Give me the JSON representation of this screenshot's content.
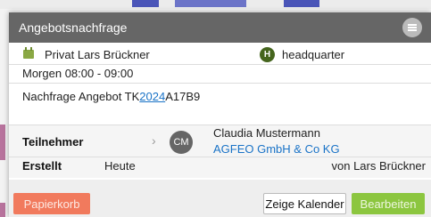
{
  "dialog": {
    "title": "Angebotsnachfrage"
  },
  "appointment": {
    "calendar": "Privat Lars Brückner",
    "location_badge": "H",
    "location": "headquarter",
    "time": "Morgen 08:00 - 09:00",
    "subject_prefix": "Nachfrage Angebot TK",
    "subject_link": "2024",
    "subject_suffix": "A17B9"
  },
  "participants": {
    "label": "Teilnehmer",
    "avatar_initials": "CM",
    "name": "Claudia Mustermann",
    "company": "AGFEO GmbH & Co KG"
  },
  "created": {
    "label": "Erstellt",
    "value": "Heute",
    "by": "von Lars Brückner"
  },
  "buttons": {
    "trash": "Papierkorb",
    "show_calendar": "Zeige Kalender",
    "edit": "Bearbeiten"
  },
  "colors": {
    "titlebar": "#666666",
    "trash_button": "#f17a5d",
    "edit_button": "#8cc63f",
    "link": "#1a73c7",
    "location_badge": "#45651e",
    "calendar_icon": "#8aa844"
  }
}
